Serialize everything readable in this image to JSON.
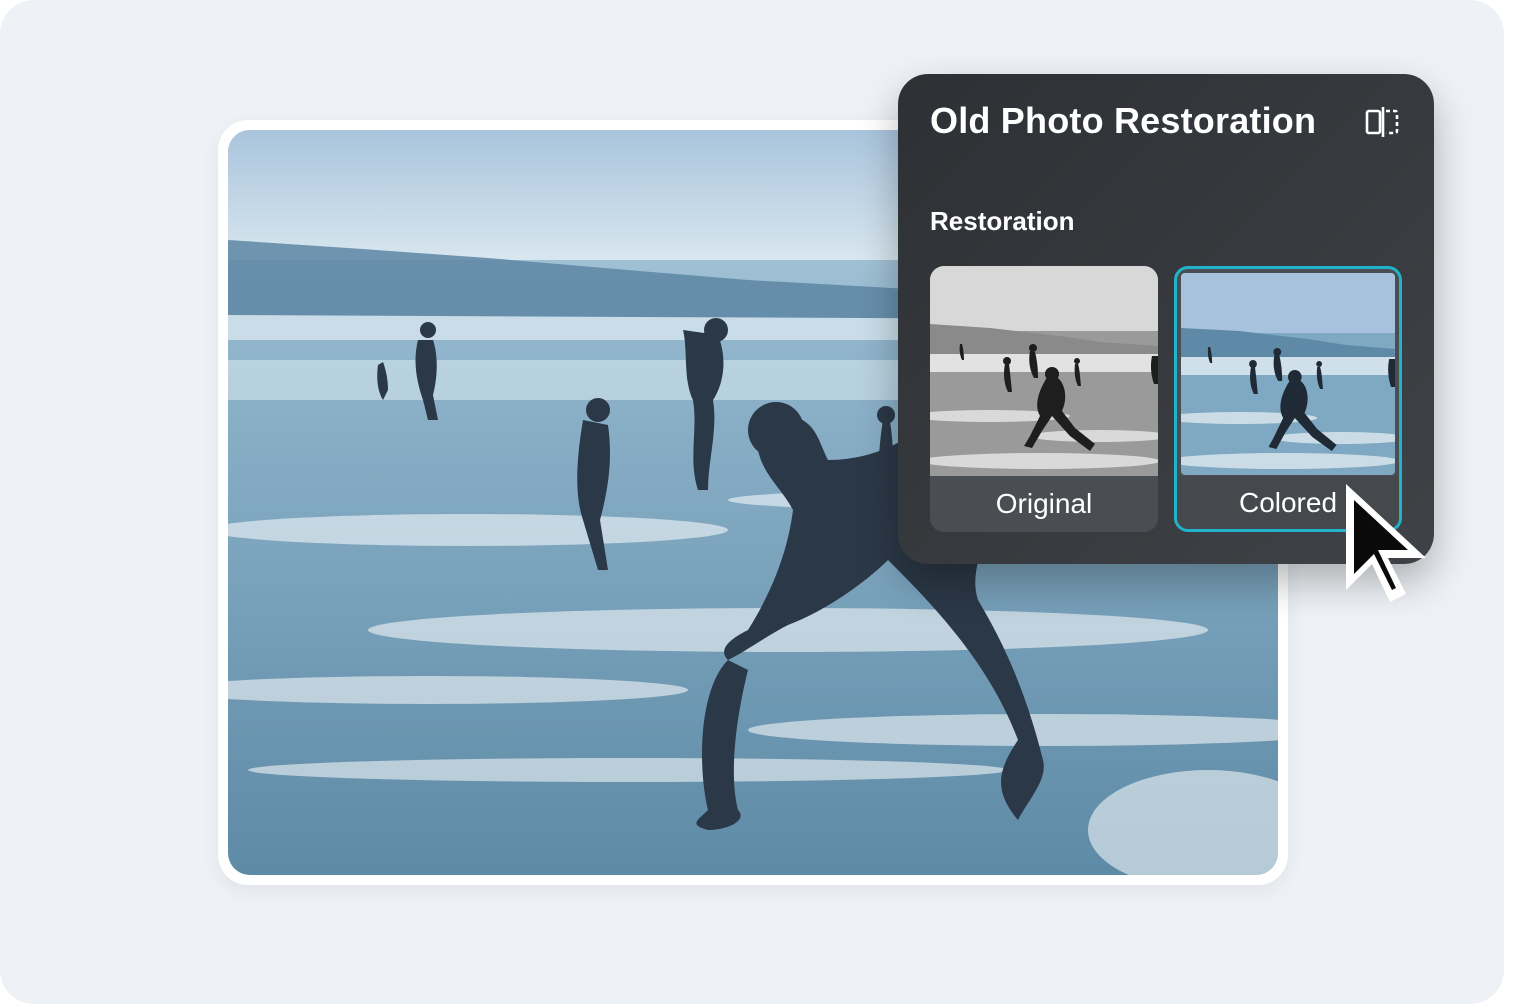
{
  "panel": {
    "title": "Old Photo Restoration",
    "section_label": "Restoration",
    "options": [
      {
        "label": "Original",
        "selected": false
      },
      {
        "label": "Colored",
        "selected": true
      }
    ],
    "compare_icon": "split-compare-icon"
  },
  "colors": {
    "background": "#eef2f6",
    "panel": "#36393d",
    "accent": "#1fb4cc"
  }
}
